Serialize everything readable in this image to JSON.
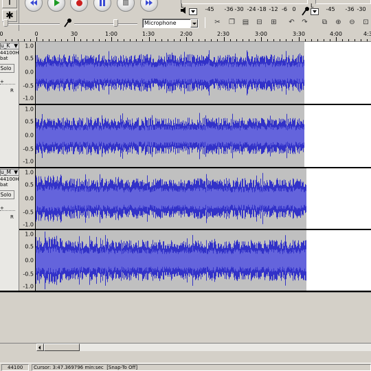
{
  "toolbar": {
    "tools": [
      {
        "name": "selection-tool",
        "glyph": "I"
      },
      {
        "name": "multi-tool",
        "glyph": "✱"
      }
    ],
    "transport": [
      {
        "name": "skip-to-start-button",
        "icon": "skip-to-start-icon"
      },
      {
        "name": "play-button",
        "icon": "play-icon"
      },
      {
        "name": "record-button",
        "icon": "record-icon"
      },
      {
        "name": "pause-button",
        "icon": "pause-icon"
      },
      {
        "name": "stop-button",
        "icon": "stop-icon"
      },
      {
        "name": "skip-to-end-button",
        "icon": "skip-to-end-icon"
      }
    ],
    "input_source": "Microphone",
    "meter_scale": [
      "-45",
      "-36",
      "-30",
      "-24",
      "-18",
      "-12",
      "-6",
      "0",
      "-45",
      "-36",
      "-30",
      "-24",
      "-18",
      "-12",
      "-6",
      "0"
    ],
    "edit_icons": [
      "cut-icon",
      "copy-icon",
      "paste-icon",
      "trim-icon",
      "silence-icon",
      "undo-icon",
      "redo-icon",
      "sync-lock-icon",
      "zoom-in-icon",
      "zoom-out-icon",
      "fit-selection-icon",
      "fit-project-icon"
    ]
  },
  "ruler": {
    "labels": [
      "0",
      "0",
      "30",
      "1:00",
      "1:30",
      "2:00",
      "2:30",
      "3:00",
      "3:30",
      "4:00",
      "4:30"
    ]
  },
  "tracks": [
    {
      "name": "u_K",
      "rate": "44100Hz",
      "format": "bat",
      "solo_label": "Solo",
      "gain_label": "+",
      "pan_label": "R",
      "scale": [
        "1.0",
        "0.5",
        "0.0",
        "-0.5",
        "-1.0"
      ],
      "end_fraction": 0.87
    },
    {
      "name": "u_M",
      "rate": "44100Hz",
      "format": "bat",
      "solo_label": "Solo",
      "gain_label": "+",
      "pan_label": "R",
      "scale": [
        "1.0",
        "0.5",
        "0.0",
        "-0.5",
        "-1.0"
      ],
      "end_fraction": 0.875
    }
  ],
  "status": {
    "project_rate": "44100",
    "cursor": "Cursor: 3:47.369796 min:sec",
    "snap": "[Snap-To Off]"
  },
  "colors": {
    "waveform": "#3232c8",
    "waveform_light": "#6464dc",
    "wave_bg": "#c0c0c0",
    "chrome": "#d4d0c8"
  }
}
